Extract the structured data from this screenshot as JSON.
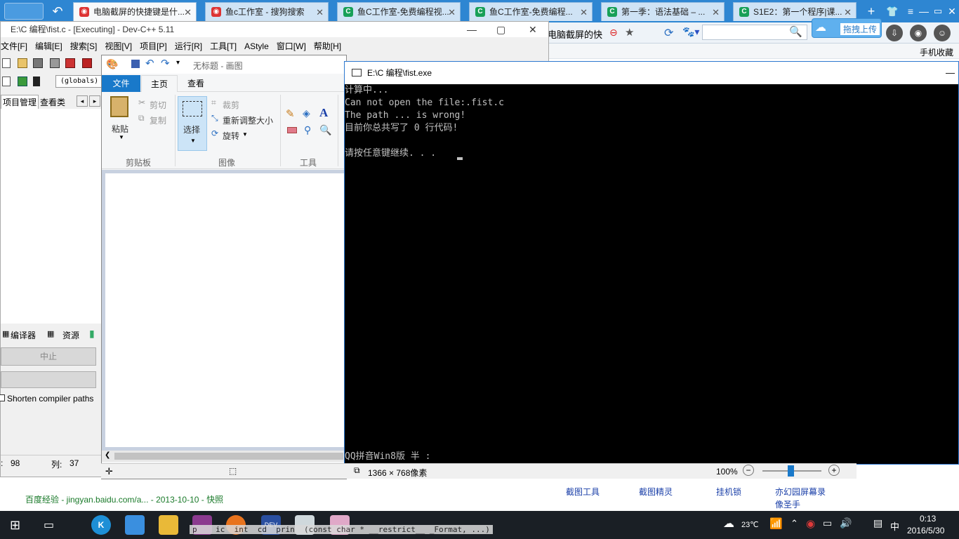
{
  "browser": {
    "tabs": [
      {
        "label": "电脑截屏的快捷键是什...",
        "active": true
      },
      {
        "label": "鱼c工作室 - 搜狗搜索"
      },
      {
        "label": "鱼C工作室-免费编程视..."
      },
      {
        "label": "鱼C工作室-免费编程..."
      },
      {
        "label": "第一季：语法基础 – ..."
      },
      {
        "label": "S1E2：第一个程序|课..."
      }
    ],
    "address_fragment": "电脑截屏的快",
    "upload_button": "拖拽上传",
    "mobile_favorites": "手机收藏"
  },
  "devcpp": {
    "title": "E:\\C 编程\\fist.c - [Executing] - Dev-C++ 5.11",
    "menu": [
      "文件[F]",
      "编辑[E]",
      "搜索[S]",
      "视图[V]",
      "项目[P]",
      "运行[R]",
      "工具[T]",
      "AStyle",
      "窗口[W]",
      "帮助[H]"
    ],
    "globals": "(globals)",
    "tab_project": "项目管理",
    "tab_classes": "查看类",
    "bottom_tabs": [
      "编译器",
      "资源"
    ],
    "stop_button": "中止",
    "shorten_paths": "Shorten compiler paths",
    "status_line_label": "",
    "status_line_value": "98",
    "status_col_label": "列:",
    "status_col_value": "37"
  },
  "paint": {
    "title": "无标题 - 画图",
    "tabs": [
      "文件",
      "主页",
      "查看"
    ],
    "paste": "粘贴",
    "cut": "剪切",
    "copy": "复制",
    "select": "选择",
    "crop": "裁剪",
    "resize": "重新调整大小",
    "rotate": "旋转",
    "group_clipboard": "剪贴板",
    "group_image": "图像",
    "group_tools": "工具",
    "canvas_size": "1366 × 768像素",
    "zoom": "100%"
  },
  "console": {
    "title": "E:\\C 编程\\fist.exe",
    "lines": [
      "计算中...",
      "Can not open the file:.fist.c",
      "The path ... is wrong!",
      "目前你总共写了 0 行代码!",
      "",
      "请按任意键继续. . . "
    ],
    "ime": "QQ拼音Win8版 半 :"
  },
  "webpage": {
    "source": "百度经验 - jingyan.baidu.com/a... - 2013-10-10 - 快照",
    "links": [
      "截图工具",
      "截图精灵",
      "挂机锁",
      "亦幻园屏幕录像圣手"
    ]
  },
  "taskbar": {
    "temp": "23℃",
    "ime": "中",
    "time": "0:13",
    "date": "2016/5/30",
    "code_hint": "p    ic  int  cd  prin  (const char * __restrict__ _Format, ...)"
  }
}
